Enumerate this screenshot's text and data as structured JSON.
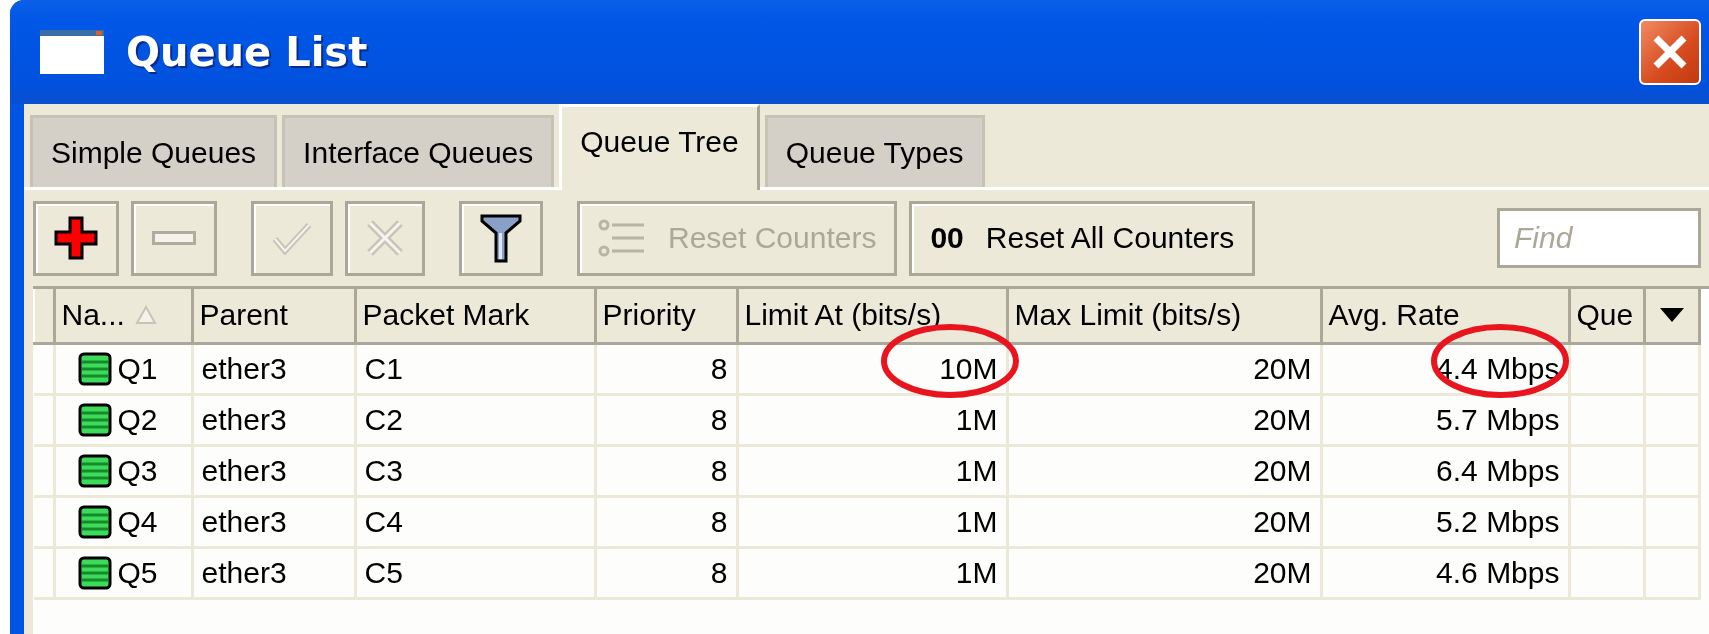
{
  "window": {
    "title": "Queue List"
  },
  "tabs": [
    {
      "label": "Simple Queues",
      "selected": false
    },
    {
      "label": "Interface Queues",
      "selected": false
    },
    {
      "label": "Queue Tree",
      "selected": true
    },
    {
      "label": "Queue Types",
      "selected": false
    }
  ],
  "toolbar": {
    "buttons": [
      {
        "kind": "add",
        "disabled": false
      },
      {
        "kind": "remove",
        "disabled": true
      },
      {
        "kind": "enable",
        "disabled": true
      },
      {
        "kind": "disable",
        "disabled": true
      },
      {
        "kind": "filter",
        "disabled": false
      },
      {
        "kind": "reset",
        "label": "Reset Counters",
        "disabled": true
      },
      {
        "kind": "reset_all",
        "badge": "00",
        "label": "Reset All Counters",
        "disabled": false
      }
    ],
    "search": {
      "placeholder": "Find"
    }
  },
  "table": {
    "columns": [
      {
        "label": "Na...",
        "sorted": true
      },
      {
        "label": "Parent"
      },
      {
        "label": "Packet Mark"
      },
      {
        "label": "Priority"
      },
      {
        "label": "Limit At (bits/s)"
      },
      {
        "label": "Max Limit (bits/s)"
      },
      {
        "label": "Avg. Rate"
      },
      {
        "label": "Que"
      }
    ],
    "rows": [
      {
        "name": "Q1",
        "parent": "ether3",
        "packet_mark": "C1",
        "priority": "8",
        "limit_at": "10M",
        "max_limit": "20M",
        "avg_rate": "4.4 Mbps",
        "circled": true
      },
      {
        "name": "Q2",
        "parent": "ether3",
        "packet_mark": "C2",
        "priority": "8",
        "limit_at": "1M",
        "max_limit": "20M",
        "avg_rate": "5.7 Mbps",
        "circled": false
      },
      {
        "name": "Q3",
        "parent": "ether3",
        "packet_mark": "C3",
        "priority": "8",
        "limit_at": "1M",
        "max_limit": "20M",
        "avg_rate": "6.4 Mbps",
        "circled": false
      },
      {
        "name": "Q4",
        "parent": "ether3",
        "packet_mark": "C4",
        "priority": "8",
        "limit_at": "1M",
        "max_limit": "20M",
        "avg_rate": "5.2 Mbps",
        "circled": false
      },
      {
        "name": "Q5",
        "parent": "ether3",
        "packet_mark": "C5",
        "priority": "8",
        "limit_at": "1M",
        "max_limit": "20M",
        "avg_rate": "4.6 Mbps",
        "circled": false
      }
    ]
  }
}
